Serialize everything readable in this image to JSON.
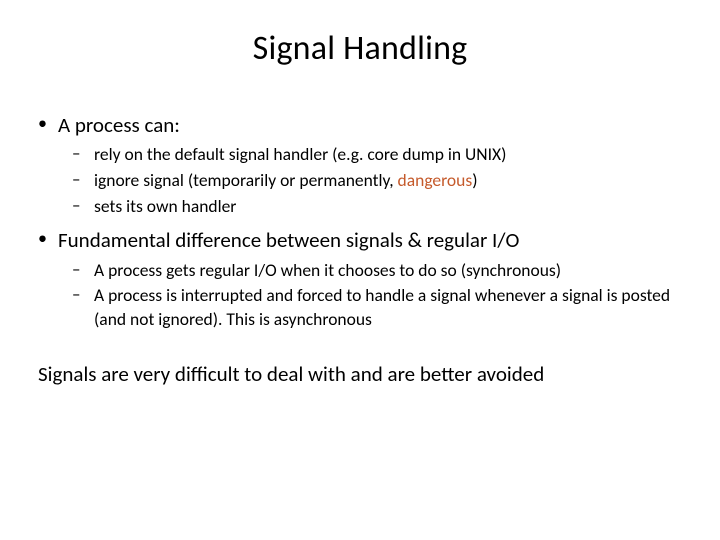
{
  "title": "Signal Handling",
  "bullets": {
    "b1": {
      "label": "A process can:",
      "sub": [
        "rely on the default signal handler (e.g. core dump in UNIX)",
        "ignore signal (temporarily or permanently, ",
        "sets its own handler"
      ],
      "danger_word": "dangerous",
      "danger_suffix": ")"
    },
    "b2": {
      "label": "Fundamental difference between signals & regular I/O",
      "sub": [
        "A process gets regular I/O when it chooses to do so (synchronous)",
        "A process is interrupted and forced to handle a signal whenever a signal is posted (and not ignored). This is asynchronous"
      ]
    }
  },
  "footer": "Signals are very difficult to deal with and are better avoided"
}
